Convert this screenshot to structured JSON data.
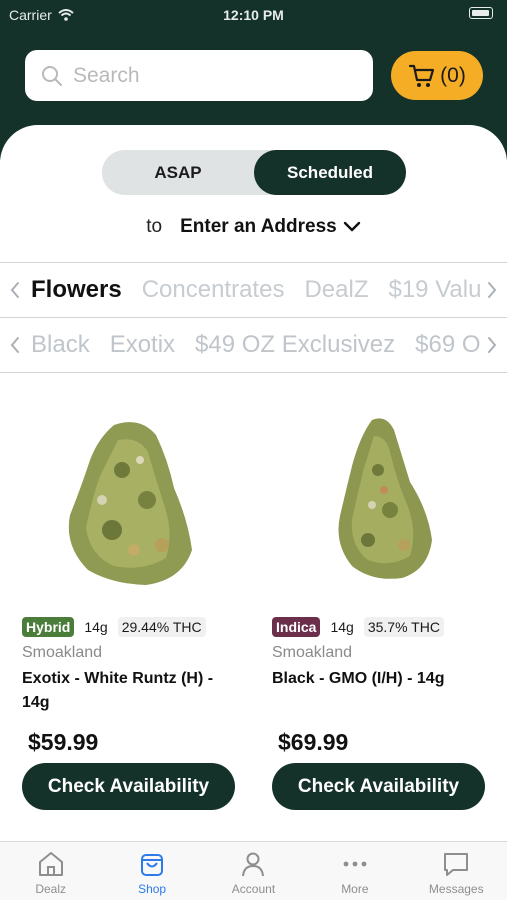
{
  "status_bar": {
    "carrier": "Carrier",
    "time": "12:10 PM"
  },
  "search": {
    "placeholder": "Search",
    "icon": "search-icon"
  },
  "cart": {
    "label": "(0)",
    "icon": "cart-icon"
  },
  "delivery_toggle": {
    "options": [
      "ASAP",
      "Scheduled"
    ],
    "selected": "Scheduled"
  },
  "address": {
    "prefix": "to",
    "value": "Enter an Address"
  },
  "categories": {
    "items": [
      "Flowers",
      "Concentrates",
      "DealZ",
      "$19 Valu"
    ],
    "selected": "Flowers"
  },
  "subcategories": {
    "items": [
      "Black",
      "Exotix",
      "$49 OZ Exclusivez",
      "$69 O"
    ]
  },
  "products": [
    {
      "type": "Hybrid",
      "type_color": "#4a7c3a",
      "weight": "14g",
      "thc": "29.44% THC",
      "brand": "Smoakland",
      "name": "Exotix - White Runtz (H) - 14g",
      "price": "$59.99",
      "button": "Check Availability"
    },
    {
      "type": "Indica",
      "type_color": "#6b2e4b",
      "weight": "14g",
      "thc": "35.7% THC",
      "brand": "Smoakland",
      "name": "Black - GMO (I/H) - 14g",
      "price": "$69.99",
      "button": "Check Availability"
    }
  ],
  "tabbar": {
    "items": [
      {
        "label": "Dealz",
        "icon": "store-icon"
      },
      {
        "label": "Shop",
        "icon": "shopping-bag-icon"
      },
      {
        "label": "Account",
        "icon": "person-icon"
      },
      {
        "label": "More",
        "icon": "more-dots-icon"
      },
      {
        "label": "Messages",
        "icon": "message-icon"
      }
    ],
    "active": "Shop"
  },
  "colors": {
    "header_bg": "#15322a",
    "cart_bg": "#f5ad25",
    "accent_tab": "#2d7bea"
  }
}
